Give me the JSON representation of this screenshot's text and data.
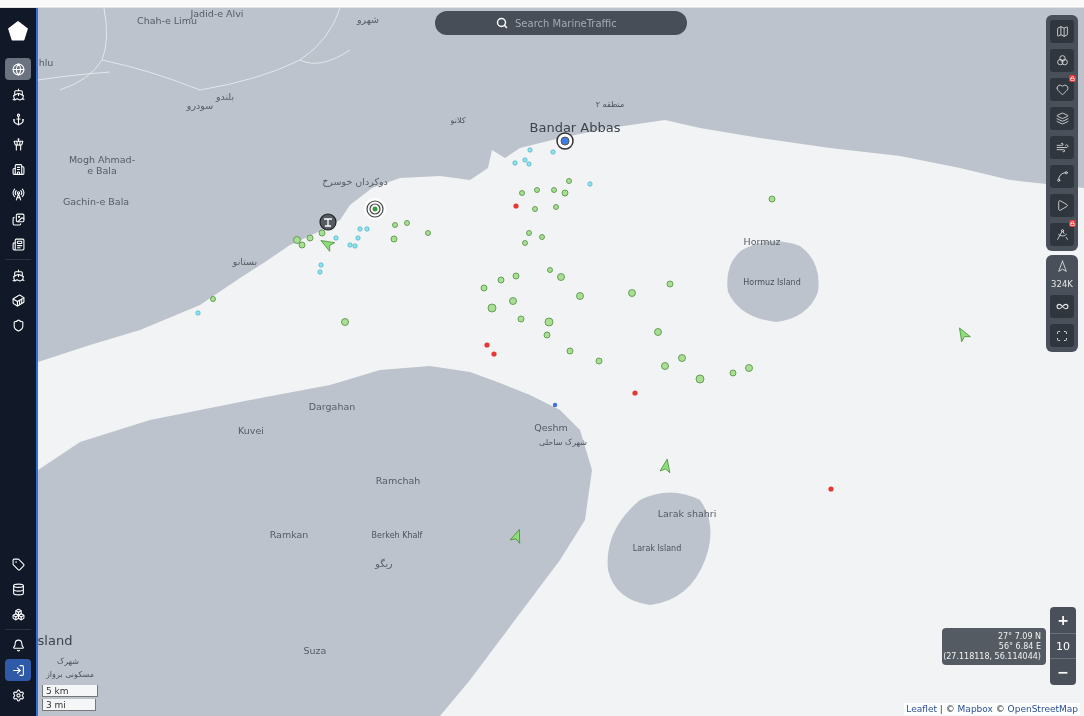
{
  "search": {
    "placeholder": "Search MarineTraffic"
  },
  "sidebar": {
    "groups": [
      {
        "items": [
          {
            "selected": true,
            "primary": false
          },
          {
            "selected": false,
            "primary": false
          },
          {
            "selected": false,
            "primary": false
          },
          {
            "selected": false,
            "primary": false
          },
          {
            "selected": false,
            "primary": false
          },
          {
            "selected": false,
            "primary": false
          },
          {
            "selected": false,
            "primary": false
          },
          {
            "selected": false,
            "primary": false
          }
        ]
      },
      {
        "items": [
          {
            "selected": false,
            "primary": false
          },
          {
            "selected": false,
            "primary": false
          },
          {
            "selected": false,
            "primary": false
          }
        ]
      },
      {
        "items": [
          {
            "selected": false,
            "primary": false
          },
          {
            "selected": false,
            "primary": false
          },
          {
            "selected": false,
            "primary": false
          }
        ]
      },
      {
        "items": [
          {
            "selected": false,
            "primary": false
          },
          {
            "selected": false,
            "primary": true
          },
          {
            "selected": false,
            "primary": false
          }
        ]
      }
    ]
  },
  "map_tools": [
    {
      "locked": false
    },
    {
      "locked": false
    },
    {
      "locked": true
    },
    {
      "locked": false
    },
    {
      "locked": false
    },
    {
      "locked": false
    },
    {
      "locked": false
    },
    {
      "locked": true
    }
  ],
  "vessel_count": "324K",
  "places": [
    {
      "text": "Jadid-e Alvi",
      "kind": "place"
    },
    {
      "text": "Chah-e Limu",
      "kind": "place"
    },
    {
      "text": "شهرو",
      "kind": "place"
    },
    {
      "text": "hlu",
      "kind": "place"
    },
    {
      "text": "بلندو",
      "kind": "place"
    },
    {
      "text": "سودرو",
      "kind": "place"
    },
    {
      "text": "منطقه ۲",
      "kind": "minor"
    },
    {
      "text": "کلانو",
      "kind": "minor"
    },
    {
      "text": "Bandar Abbas",
      "kind": "major"
    },
    {
      "text": "Mogh Ahmad-e Bala",
      "kind": "place"
    },
    {
      "text": "Gachin-e Bala",
      "kind": "place"
    },
    {
      "text": "دوکردان خوسرخ",
      "kind": "place"
    },
    {
      "text": "بستانو",
      "kind": "place"
    },
    {
      "text": "Hormuz",
      "kind": "place"
    },
    {
      "text": "Hormuz Island",
      "kind": "minor"
    },
    {
      "text": "Dargahan",
      "kind": "place"
    },
    {
      "text": "Kuvei",
      "kind": "place"
    },
    {
      "text": "Qeshm",
      "kind": "place"
    },
    {
      "text": "شهرک ساحلی",
      "kind": "minor"
    },
    {
      "text": "Ramchah",
      "kind": "place"
    },
    {
      "text": "Larak shahri",
      "kind": "place"
    },
    {
      "text": "Larak Island",
      "kind": "minor"
    },
    {
      "text": "Ramkan",
      "kind": "place"
    },
    {
      "text": "Berkeh Khalf",
      "kind": "minor"
    },
    {
      "text": "ریگو",
      "kind": "place"
    },
    {
      "text": "Suza",
      "kind": "place"
    },
    {
      "text": "sland",
      "kind": "major"
    },
    {
      "text": "شهرک",
      "kind": "minor"
    },
    {
      "text": "مسکونی برواز",
      "kind": "minor"
    }
  ],
  "zoom": {
    "zoom_in": "+",
    "zoom_level": "10",
    "zoom_out": "−"
  },
  "coordinates": [
    "27° 7.09 N",
    "56° 6.84 E",
    "(27.118118, 56.114044)"
  ],
  "scale": [
    "5 km",
    "3 mi"
  ],
  "attribution": [
    {
      "text": "Leaflet",
      "link": true
    },
    {
      "text": " | © ",
      "link": false
    },
    {
      "text": "Mapbox",
      "link": true
    },
    {
      "text": " © ",
      "link": false
    },
    {
      "text": "OpenStreetMap",
      "link": true
    }
  ]
}
